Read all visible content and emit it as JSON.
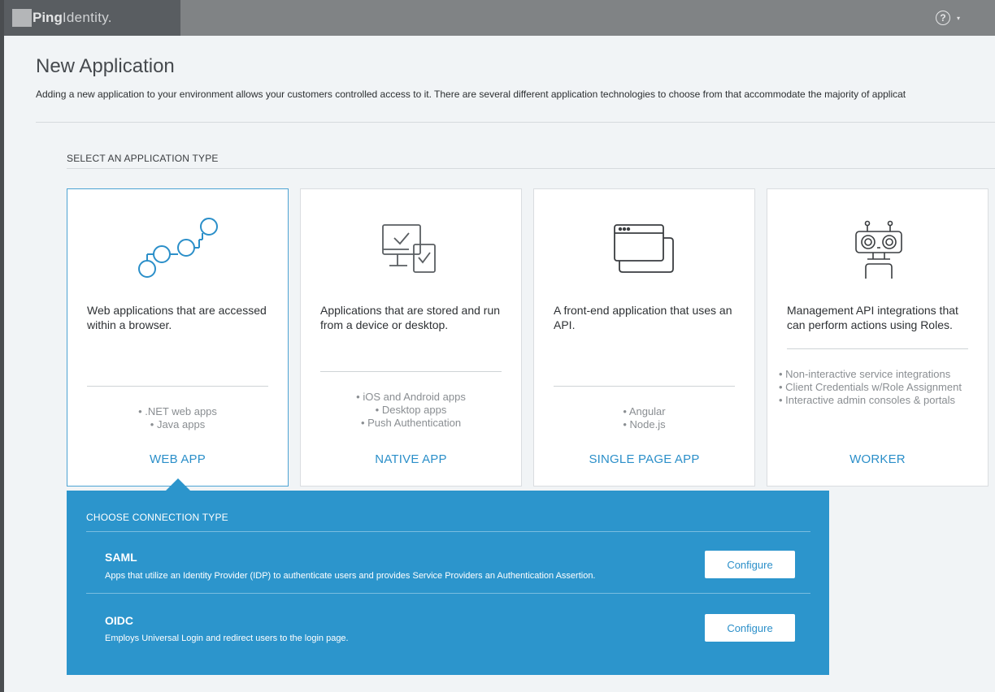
{
  "brand": {
    "name_bold": "Ping",
    "name_light": "Identity."
  },
  "header": {
    "help_icon": "question-circle-icon",
    "menu_caret": "▾"
  },
  "page": {
    "title": "New Application",
    "description": "Adding a new application to your environment allows your customers controlled access to it. There are several different application technologies to choose from that accommodate the majority of applicat"
  },
  "section": {
    "title": "SELECT AN APPLICATION TYPE"
  },
  "cards": [
    {
      "icon": "workflow-nodes-icon",
      "description": "Web applications that are accessed within a browser.",
      "bullets": [
        ".NET web apps",
        "Java apps"
      ],
      "type_label": "WEB APP",
      "selected": true
    },
    {
      "icon": "desktop-device-check-icon",
      "description": "Applications that are stored and run from a device or desktop.",
      "bullets": [
        "iOS and Android apps",
        "Desktop apps",
        "Push Authentication"
      ],
      "type_label": "NATIVE APP",
      "selected": false
    },
    {
      "icon": "browser-windows-icon",
      "description": "A front-end application that uses an API.",
      "bullets": [
        "Angular",
        "Node.js"
      ],
      "type_label": "SINGLE PAGE APP",
      "selected": false
    },
    {
      "icon": "robot-icon",
      "description": "Management API integrations that can perform actions using Roles.",
      "bullets": [
        "Non-interactive service integrations",
        "Client Credentials w/Role Assignment",
        "Interactive admin consoles & portals"
      ],
      "type_label": "WORKER",
      "selected": false
    }
  ],
  "connection": {
    "title": "CHOOSE CONNECTION TYPE",
    "items": [
      {
        "name": "SAML",
        "description": "Apps that utilize an Identity Provider (IDP) to authenticate users and provides Service Providers an Authentication Assertion.",
        "button_label": "Configure"
      },
      {
        "name": "OIDC",
        "description": "Employs Universal Login and redirect users to the login page.",
        "button_label": "Configure"
      }
    ]
  },
  "colors": {
    "accent": "#2c95cc",
    "link": "#2b8fc9",
    "topbar": "#808385",
    "logo_bg": "#595d61"
  }
}
